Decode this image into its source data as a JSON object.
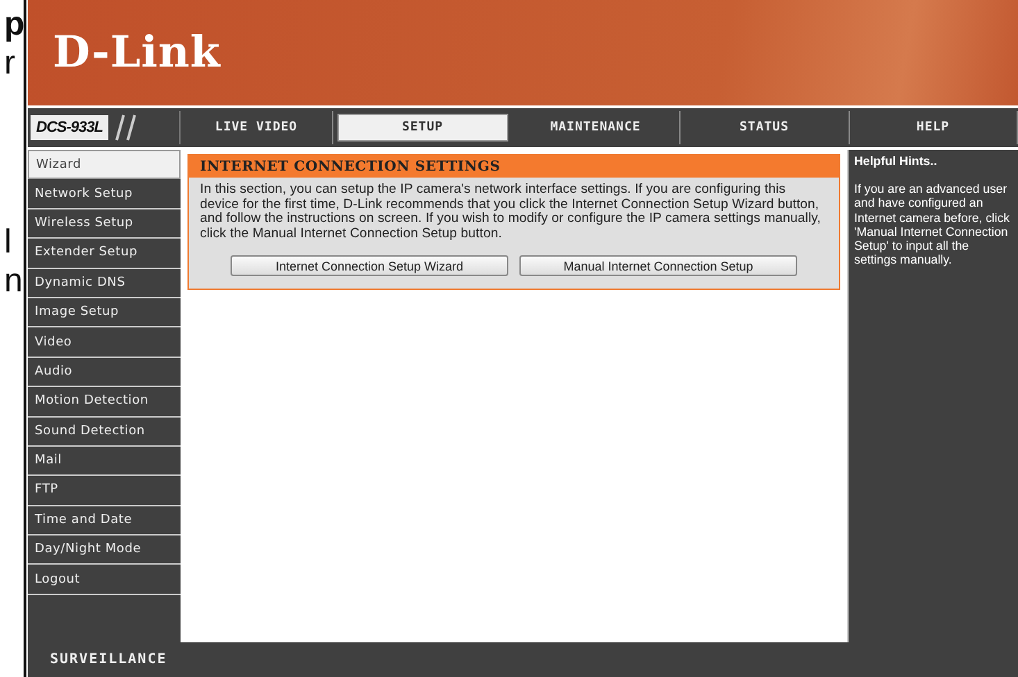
{
  "margin_fragments": [
    {
      "text": "p",
      "bold": true
    },
    {
      "text": "r",
      "bold": false
    },
    {
      "text": "l",
      "bold": false
    },
    {
      "text": "n",
      "bold": false
    }
  ],
  "header": {
    "logo": "D-Link"
  },
  "model": "DCS-933L",
  "tabs": [
    {
      "label": "LIVE VIDEO",
      "selected": false
    },
    {
      "label": "SETUP",
      "selected": true
    },
    {
      "label": "MAINTENANCE",
      "selected": false
    },
    {
      "label": "STATUS",
      "selected": false
    },
    {
      "label": "HELP",
      "selected": false
    }
  ],
  "sidebar": {
    "items": [
      {
        "label": "Wizard",
        "selected": true
      },
      {
        "label": "Network Setup",
        "selected": false
      },
      {
        "label": "Wireless Setup",
        "selected": false
      },
      {
        "label": "Extender Setup",
        "selected": false
      },
      {
        "label": "Dynamic DNS",
        "selected": false
      },
      {
        "label": "Image Setup",
        "selected": false
      },
      {
        "label": "Video",
        "selected": false
      },
      {
        "label": "Audio",
        "selected": false
      },
      {
        "label": "Motion Detection",
        "selected": false
      },
      {
        "label": "Sound Detection",
        "selected": false
      },
      {
        "label": "Mail",
        "selected": false
      },
      {
        "label": "FTP",
        "selected": false
      },
      {
        "label": "Time and Date",
        "selected": false
      },
      {
        "label": "Day/Night Mode",
        "selected": false
      },
      {
        "label": "Logout",
        "selected": false
      }
    ]
  },
  "panel": {
    "title": "INTERNET CONNECTION SETTINGS",
    "text": "In this section, you can setup the IP camera's network interface settings. If you are configuring this device for the first time, D-Link recommends that you click the Internet Connection Setup Wizard button, and follow the instructions on screen. If you wish to modify or configure the IP camera settings manually, click the Manual Internet Connection Setup button.",
    "buttons": [
      "Internet Connection Setup Wizard",
      "Manual Internet Connection Setup"
    ]
  },
  "hints": {
    "title": "Helpful Hints..",
    "text": "If you are an advanced user and have configured an Internet camera before, click 'Manual Internet Connection Setup' to input all the settings manually."
  },
  "footer": {
    "brand": "SURVEILLANCE"
  }
}
